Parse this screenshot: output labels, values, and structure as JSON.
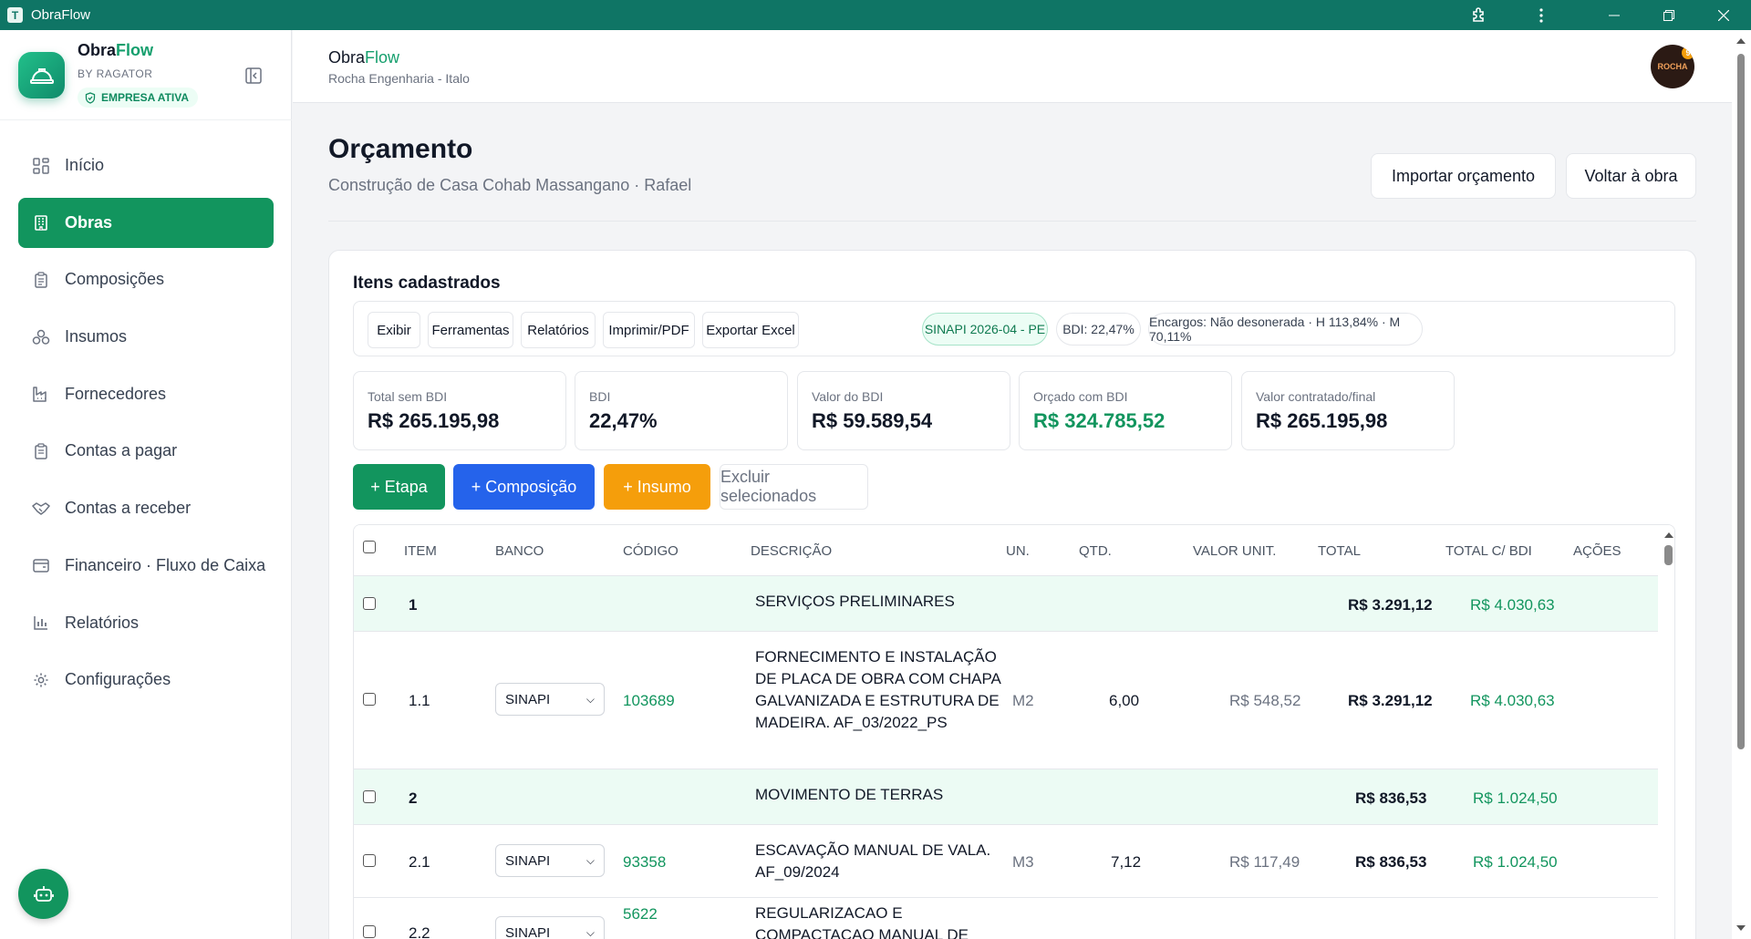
{
  "window": {
    "app_icon_letter": "T",
    "title": "ObraFlow"
  },
  "sidebar": {
    "brand": {
      "name_a": "Obra",
      "name_b": "Flow",
      "by": "BY RAGATOR",
      "badge": "EMPRESA ATIVA"
    },
    "items": [
      {
        "label": "Início",
        "icon": "grid-icon",
        "active": false
      },
      {
        "label": "Obras",
        "icon": "building-icon",
        "active": true
      },
      {
        "label": "Composições",
        "icon": "clipboard-icon",
        "active": false
      },
      {
        "label": "Insumos",
        "icon": "boxes-icon",
        "active": false
      },
      {
        "label": "Fornecedores",
        "icon": "factory-icon",
        "active": false
      },
      {
        "label": "Contas a pagar",
        "icon": "clipboard-list-icon",
        "active": false
      },
      {
        "label": "Contas a receber",
        "icon": "handshake-icon",
        "active": false
      },
      {
        "label": "Financeiro · Fluxo de Caixa",
        "icon": "wallet-icon",
        "active": false
      },
      {
        "label": "Relatórios",
        "icon": "bar-chart-icon",
        "active": false
      },
      {
        "label": "Configurações",
        "icon": "gear-icon",
        "active": false
      }
    ]
  },
  "header": {
    "brand_a": "Obra",
    "brand_b": "Flow",
    "subtitle": "Rocha Engenharia - Italo",
    "avatar_text": "ROCHA",
    "avatar_badge": "9"
  },
  "page": {
    "title": "Orçamento",
    "subtitle": "Construção de Casa Cohab Massangano · Rafael",
    "import_button": "Importar orçamento",
    "back_button": "Voltar à obra"
  },
  "card": {
    "title": "Itens cadastrados",
    "toolbar": [
      "Exibir",
      "Ferramentas",
      "Relatórios",
      "Imprimir/PDF",
      "Exportar Excel"
    ],
    "chips": {
      "sinapi": "SINAPI 2026-04 - PE",
      "bdi": "BDI: 22,47%",
      "encargos": "Encargos: Não desonerada · H 113,84% · M 70,11%"
    },
    "kpis": [
      {
        "label": "Total sem BDI",
        "value": "R$ 265.195,98"
      },
      {
        "label": "BDI",
        "value": "22,47%"
      },
      {
        "label": "Valor do BDI",
        "value": "R$ 59.589,54"
      },
      {
        "label": "Orçado com BDI",
        "value": "R$ 324.785,52"
      },
      {
        "label": "Valor contratado/final",
        "value": "R$ 265.195,98"
      }
    ],
    "actions": {
      "etapa": "+ Etapa",
      "composicao": "+ Composição",
      "insumo": "+ Insumo",
      "excluir": "Excluir selecionados"
    }
  },
  "table": {
    "headers": [
      "ITEM",
      "BANCO",
      "CÓDIGO",
      "DESCRIÇÃO",
      "UN.",
      "QTD.",
      "VALOR UNIT.",
      "TOTAL",
      "TOTAL C/ BDI",
      "AÇÕES"
    ],
    "rows": [
      {
        "type": "etapa",
        "item": "1",
        "descricao": "SERVIÇOS PRELIMINARES",
        "total": "R$ 3.291,12",
        "total_bdi": "R$ 4.030,63"
      },
      {
        "type": "item",
        "item": "1.1",
        "banco": "SINAPI",
        "codigo": "103689",
        "descricao": "FORNECIMENTO E INSTALAÇÃO DE PLACA DE OBRA COM CHAPA GALVANIZADA E ESTRUTURA DE MADEIRA. AF_03/2022_PS",
        "un": "M2",
        "qtd": "6,00",
        "valor_unit": "R$ 548,52",
        "total": "R$ 3.291,12",
        "total_bdi": "R$ 4.030,63"
      },
      {
        "type": "etapa",
        "item": "2",
        "descricao": "MOVIMENTO DE TERRAS",
        "total": "R$ 836,53",
        "total_bdi": "R$ 1.024,50"
      },
      {
        "type": "item",
        "item": "2.1",
        "banco": "SINAPI",
        "codigo": "93358",
        "descricao": "ESCAVAÇÃO MANUAL DE VALA. AF_09/2024",
        "un": "M3",
        "qtd": "7,12",
        "valor_unit": "R$ 117,49",
        "total": "R$ 836,53",
        "total_bdi": "R$ 1.024,50"
      },
      {
        "type": "item",
        "item": "2.2",
        "banco": "SINAPI",
        "codigo": "5622",
        "descricao": "REGULARIZACAO E COMPACTACAO MANUAL DE",
        "un": "",
        "qtd": "",
        "valor_unit": "",
        "total": "",
        "total_bdi": ""
      }
    ]
  }
}
